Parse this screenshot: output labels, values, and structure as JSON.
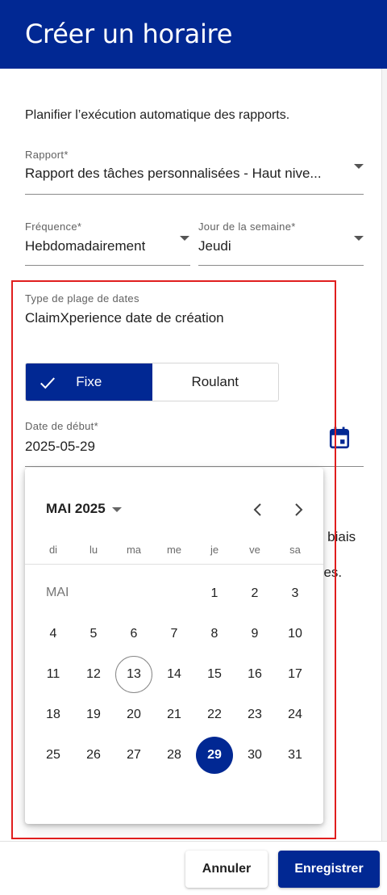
{
  "dialog": {
    "title": "Créer un horaire"
  },
  "intro": "Planifier l’exécution automatique des rapports.",
  "report": {
    "label": "Rapport*",
    "value": "Rapport des tâches personnalisées - Haut nive..."
  },
  "frequency": {
    "label": "Fréquence*",
    "value": "Hebdomadairement"
  },
  "weekday": {
    "label": "Jour de la semaine*",
    "value": "Jeudi"
  },
  "date_range_type": {
    "label": "Type de plage de dates",
    "value": "ClaimXperience date de création"
  },
  "range_toggle": {
    "fixed": "Fixe",
    "rolling": "Roulant",
    "selected": "Fixe"
  },
  "start_date": {
    "label": "Date de début*",
    "value": "2025-05-29"
  },
  "behind_text": [
    "e biais",
    "s",
    "ées."
  ],
  "calendar": {
    "month_year": "MAI 2025",
    "month_short": "MAI",
    "weekdays": [
      "di",
      "lu",
      "ma",
      "me",
      "je",
      "ve",
      "sa"
    ],
    "weeks": [
      [
        "",
        "",
        "",
        "",
        "1",
        "2",
        "3"
      ],
      [
        "4",
        "5",
        "6",
        "7",
        "8",
        "9",
        "10"
      ],
      [
        "11",
        "12",
        "13",
        "14",
        "15",
        "16",
        "17"
      ],
      [
        "18",
        "19",
        "20",
        "21",
        "22",
        "23",
        "24"
      ],
      [
        "25",
        "26",
        "27",
        "28",
        "29",
        "30",
        "31"
      ]
    ],
    "today": "13",
    "selected": "29"
  },
  "footer": {
    "cancel": "Annuler",
    "save": "Enregistrer"
  },
  "colors": {
    "primary": "#012893",
    "highlight": "#e01e1e"
  }
}
